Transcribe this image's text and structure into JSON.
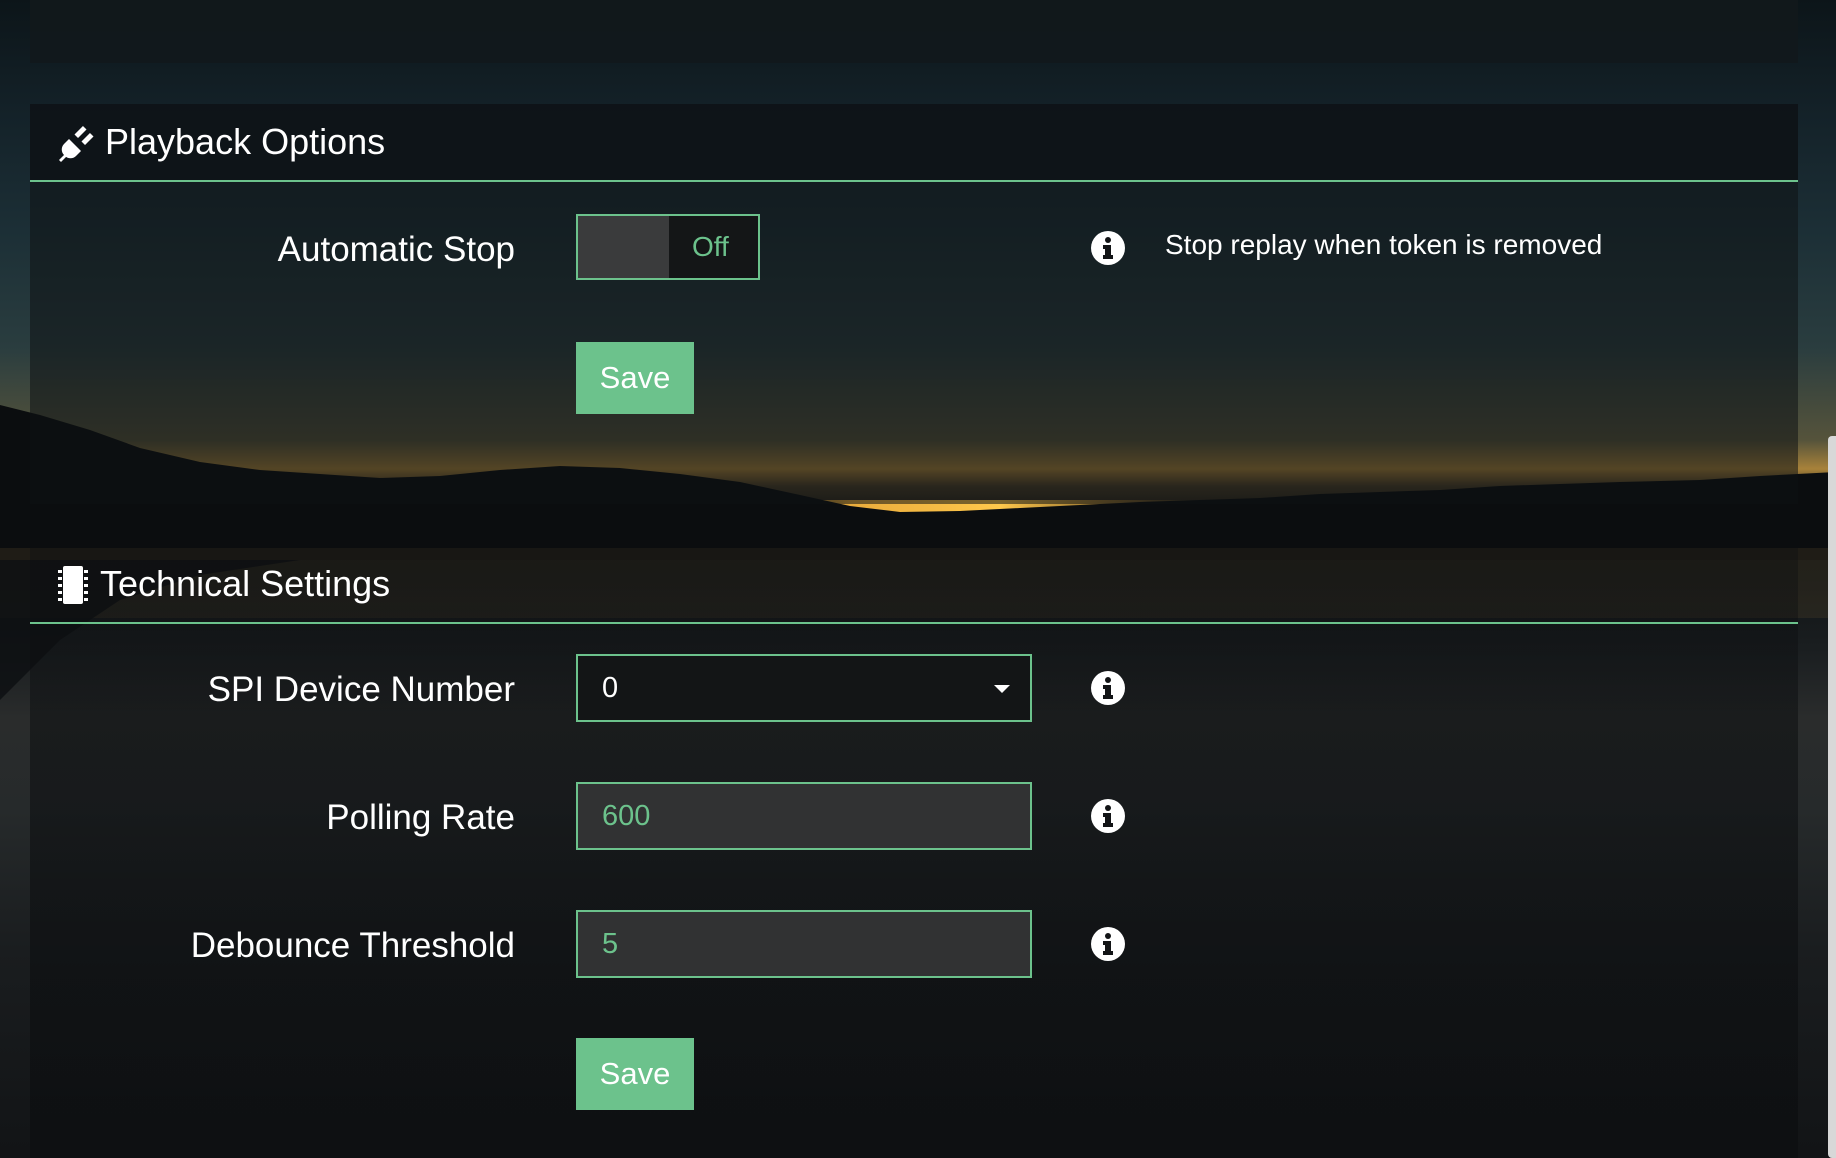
{
  "playback": {
    "title": "Playback Options",
    "icon": "plug-icon",
    "automatic_stop": {
      "label": "Automatic Stop",
      "toggle_text": "Off",
      "help": "Stop replay when token is removed"
    },
    "save_label": "Save"
  },
  "technical": {
    "title": "Technical Settings",
    "icon": "microchip-icon",
    "spi_device": {
      "label": "SPI Device Number",
      "value": "0"
    },
    "polling_rate": {
      "label": "Polling Rate",
      "value": "600"
    },
    "debounce": {
      "label": "Debounce Threshold",
      "value": "5"
    },
    "save_label": "Save"
  },
  "colors": {
    "accent": "#6cc28c",
    "panel_header": "#0e1418",
    "input_bg": "#313233"
  }
}
